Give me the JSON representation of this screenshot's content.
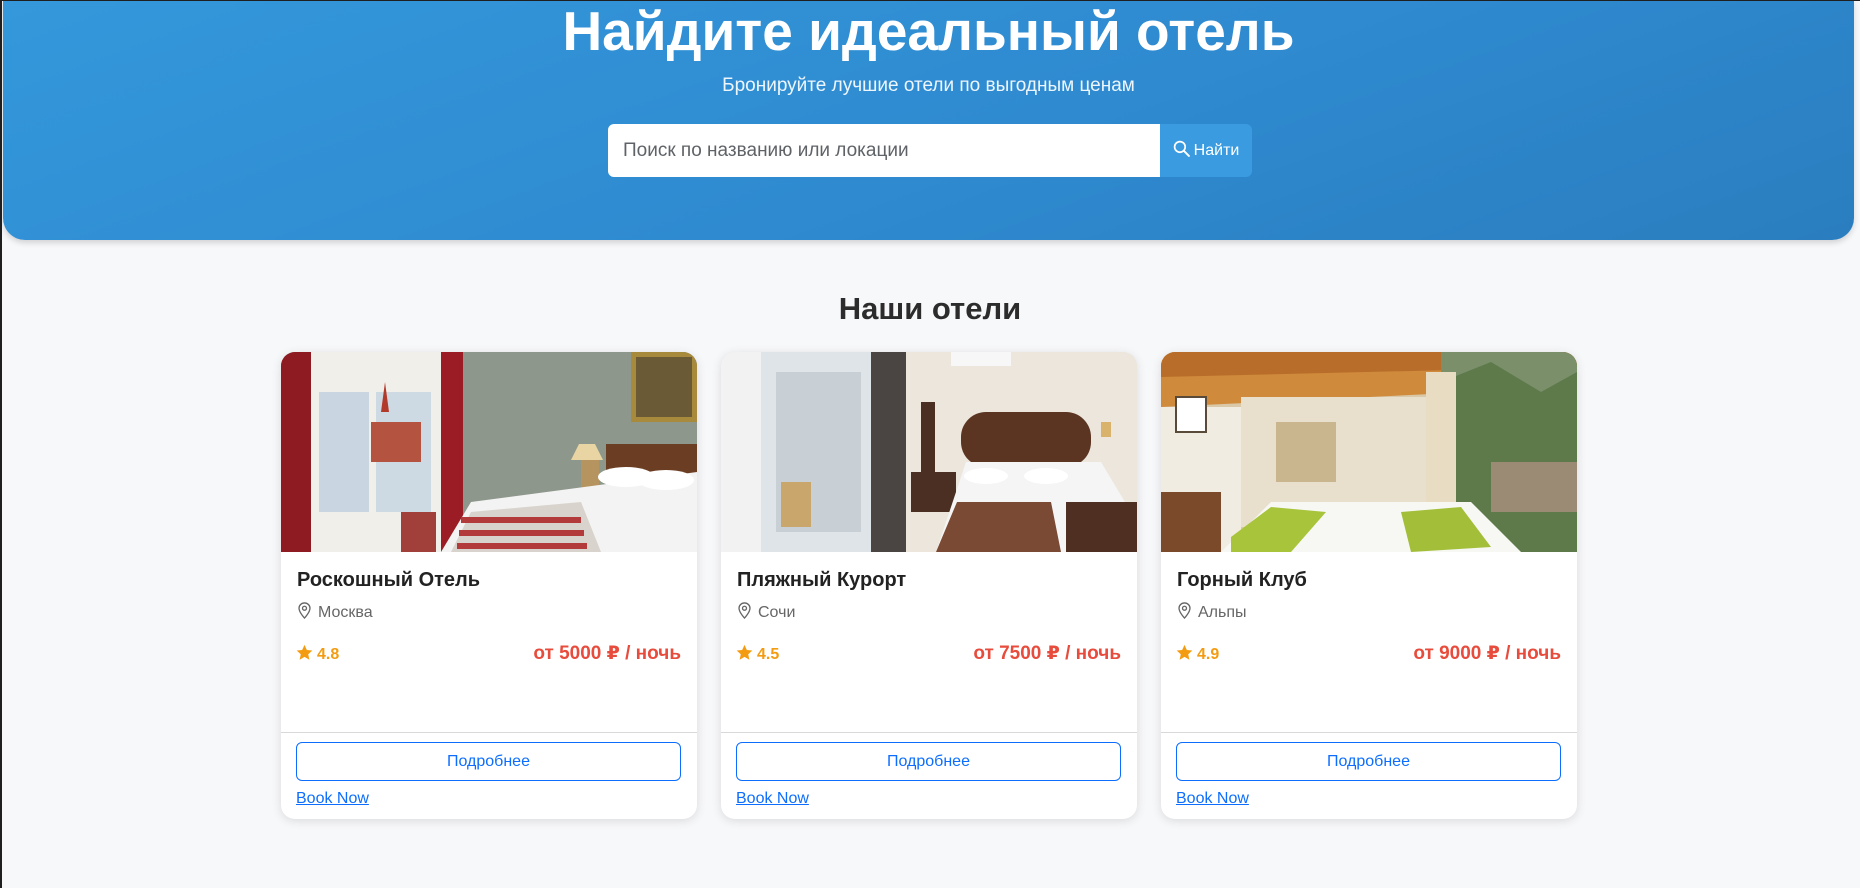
{
  "hero": {
    "title": "Найдите идеальный отель",
    "subtitle": "Бронируйте лучшие отели по выгодным ценам",
    "search_placeholder": "Поиск по названию или локации",
    "search_value": "",
    "search_button_label": "Найти",
    "search_icon": "search-icon"
  },
  "section": {
    "title": "Наши отели"
  },
  "hotels": [
    {
      "name": "Роскошный Отель",
      "location": "Москва",
      "rating": "4.8",
      "price": "от 5000 ₽ / ночь",
      "details_label": "Подробнее",
      "book_label": "Book Now",
      "image": "hotel-room-photo-moscow"
    },
    {
      "name": "Пляжный Курорт",
      "location": "Сочи",
      "rating": "4.5",
      "price": "от 7500 ₽ / ночь",
      "details_label": "Подробнее",
      "book_label": "Book Now",
      "image": "hotel-room-photo-sochi"
    },
    {
      "name": "Горный Клуб",
      "location": "Альпы",
      "rating": "4.9",
      "price": "от 9000 ₽ / ночь",
      "details_label": "Подробнее",
      "book_label": "Book Now",
      "image": "hotel-room-photo-alps"
    }
  ],
  "colors": {
    "hero_gradient_start": "#3498db",
    "hero_gradient_end": "#2a7ebf",
    "rating": "#f39c12",
    "price": "#e74c3c",
    "primary": "#0d6efd",
    "page_background": "#f7f8fa"
  },
  "icons": {
    "location": "map-pin-icon",
    "rating": "star-icon"
  }
}
